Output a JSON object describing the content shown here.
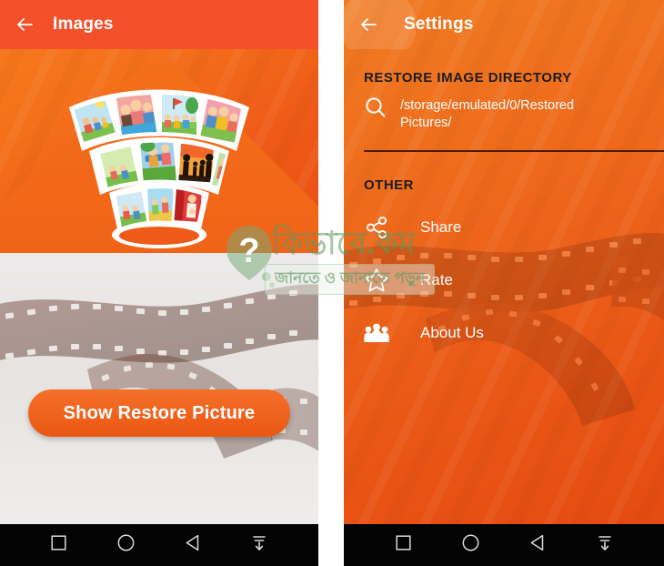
{
  "left_screen": {
    "appbar": {
      "back_icon": "arrow-left-icon",
      "title": "Images"
    },
    "illustration": {
      "name": "photo-fan-illustration",
      "alt": "fan of family photographs"
    },
    "cta_button": {
      "label": "Show Restore Picture"
    }
  },
  "right_screen": {
    "appbar": {
      "back_icon": "arrow-left-icon",
      "title": "Settings"
    },
    "sections": [
      {
        "heading": "RESTORE IMAGE DIRECTORY",
        "search_icon": "search-icon",
        "directory_path": "/storage/emulated/0/Restored Pictures/"
      },
      {
        "heading": "OTHER",
        "items": [
          {
            "icon": "share-icon",
            "label": "Share"
          },
          {
            "icon": "star-icon",
            "label": "Rate"
          },
          {
            "icon": "people-icon",
            "label": "About Us"
          }
        ]
      }
    ]
  },
  "navbar": {
    "buttons": [
      {
        "icon": "recents-square-icon",
        "label": "Recents"
      },
      {
        "icon": "home-circle-icon",
        "label": "Home"
      },
      {
        "icon": "back-triangle-icon",
        "label": "Back"
      },
      {
        "icon": "hide-navbar-icon",
        "label": "Hide navigation bar"
      }
    ]
  },
  "watermark": {
    "title": "কিভাবে.কম",
    "tagline": "জানতে ও জানাতে পড়ুন",
    "mark_icon": "question-balloon-icon"
  },
  "colors": {
    "accent_orange": "#ee5a18",
    "appbar_orange": "#f4502a",
    "navbar_black": "#030303",
    "heading_dark": "#1d1d1d",
    "text_white": "#ffffff",
    "watermark_green": "#609860"
  }
}
